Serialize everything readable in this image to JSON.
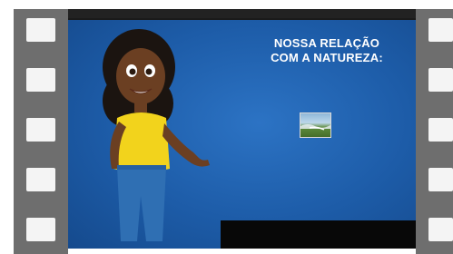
{
  "video": {
    "title_line_1": "NOSSA RELAÇÃO",
    "title_line_2": "COM A NATUREZA:"
  },
  "colors": {
    "background_blue": "#1d5ca8",
    "film_gray": "#6e6e6e",
    "shirt_yellow": "#f2d31c",
    "jeans_blue": "#2f6fb3"
  },
  "icons": {
    "thumbnail": "landscape-thumbnail-icon",
    "character": "cartoon-girl-character"
  }
}
